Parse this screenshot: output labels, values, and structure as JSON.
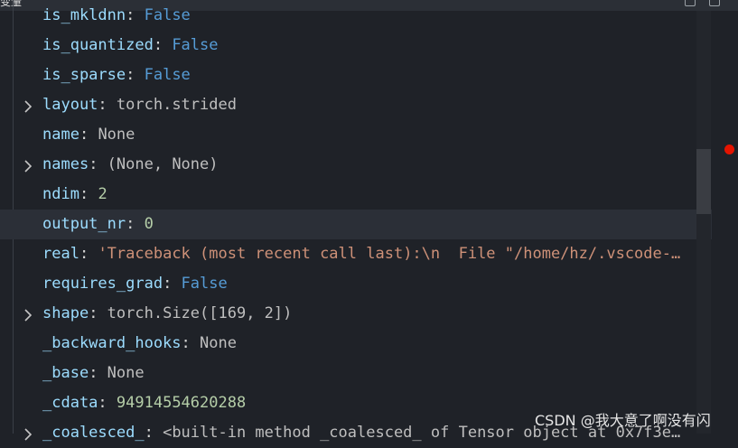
{
  "header": {
    "title": "变量"
  },
  "variables": [
    {
      "key": "is_mkldnn",
      "value": "False",
      "type": "bool",
      "expandable": false
    },
    {
      "key": "is_quantized",
      "value": "False",
      "type": "bool",
      "expandable": false
    },
    {
      "key": "is_sparse",
      "value": "False",
      "type": "bool",
      "expandable": false
    },
    {
      "key": "layout",
      "value": "torch.strided",
      "type": "plain",
      "expandable": true
    },
    {
      "key": "name",
      "value": "None",
      "type": "plain",
      "expandable": false
    },
    {
      "key": "names",
      "value": "(None, None)",
      "type": "plain",
      "expandable": true
    },
    {
      "key": "ndim",
      "value": "2",
      "type": "num",
      "expandable": false
    },
    {
      "key": "output_nr",
      "value": "0",
      "type": "num",
      "expandable": false,
      "highlight": true
    },
    {
      "key": "real",
      "value": "'Traceback (most recent call last):\\n  File \"/home/hz/.vscode-…",
      "type": "str",
      "expandable": false
    },
    {
      "key": "requires_grad",
      "value": "False",
      "type": "bool",
      "expandable": false
    },
    {
      "key": "shape",
      "value": "torch.Size([169, 2])",
      "type": "plain",
      "expandable": true
    },
    {
      "key": "_backward_hooks",
      "value": "None",
      "type": "plain",
      "expandable": false
    },
    {
      "key": "_base",
      "value": "None",
      "type": "plain",
      "expandable": false
    },
    {
      "key": "_cdata",
      "value": "94914554620288",
      "type": "num",
      "expandable": false
    },
    {
      "key": "_coalesced_",
      "value": "<built-in method _coalesced_ of Tensor object at 0x7f3e…",
      "type": "plain",
      "expandable": true
    }
  ],
  "separator": ": ",
  "watermark": "CSDN @我大意了啊没有闪",
  "colors": {
    "key": "#9cdcfe",
    "bool": "#569cd6",
    "num": "#b5cea8",
    "str": "#ce9178",
    "plain": "#bfbfbf",
    "breakpoint": "#e51400"
  }
}
